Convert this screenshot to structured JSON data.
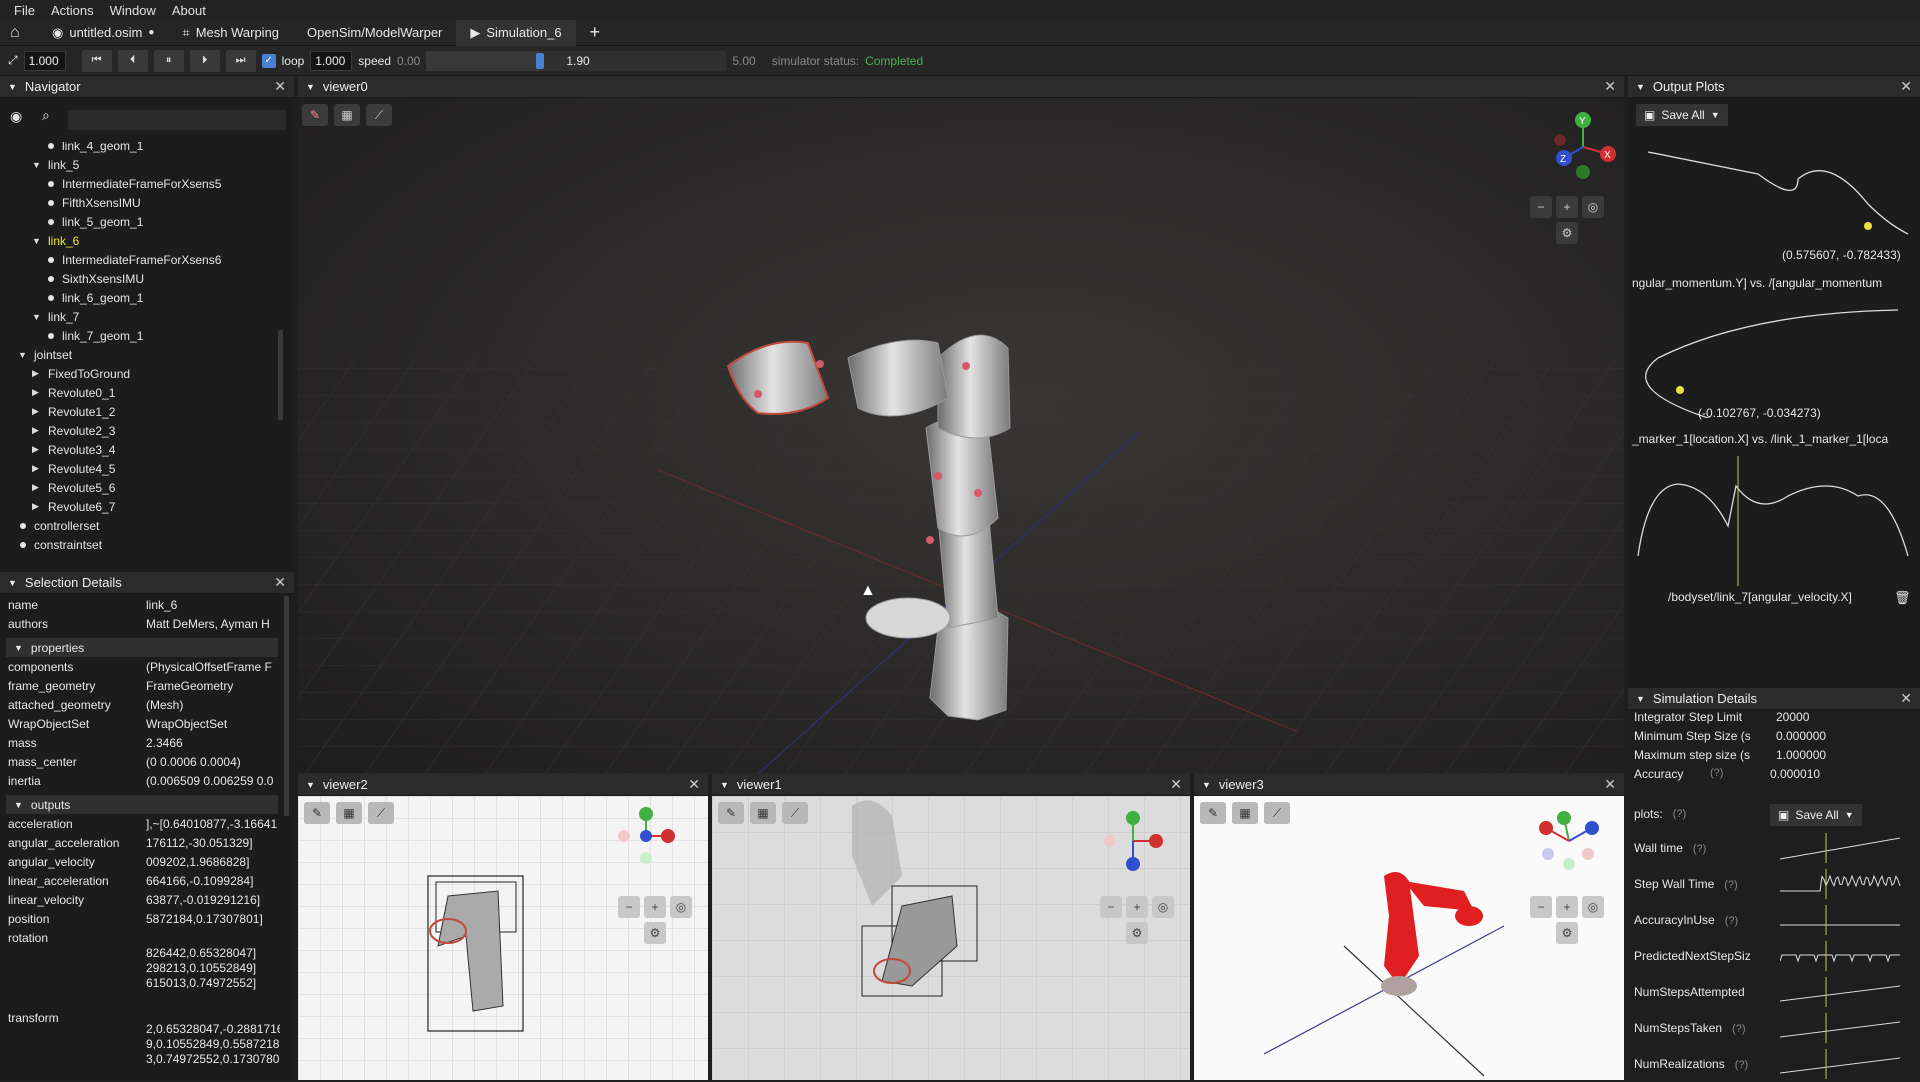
{
  "menu": [
    "File",
    "Actions",
    "Window",
    "About"
  ],
  "tabs": [
    {
      "label": "untitled.osim",
      "modified": "●",
      "icon": "model-icon"
    },
    {
      "label": "Mesh Warping",
      "icon": "mesh-warp-icon"
    },
    {
      "label": "OpenSim/ModelWarper",
      "icon": ""
    },
    {
      "label": "Simulation_6",
      "icon": "play-icon"
    }
  ],
  "toolbar": {
    "scale": "1.000",
    "loop_label": "loop",
    "loop_value": "1.000",
    "speed_label": "speed",
    "time_start": "0.00",
    "time_current": "1.90",
    "time_end": "5.00",
    "status_label": "simulator status:",
    "status_value": "Completed",
    "time_fraction": 0.38
  },
  "navigator": {
    "title": "Navigator",
    "items": [
      {
        "label": "link_4_geom_1",
        "type": "dot",
        "level": 3
      },
      {
        "label": "link_5",
        "type": "open",
        "level": 2
      },
      {
        "label": "IntermediateFrameForXsens5",
        "type": "dot",
        "level": 3
      },
      {
        "label": "FifthXsensIMU",
        "type": "dot",
        "level": 3
      },
      {
        "label": "link_5_geom_1",
        "type": "dot",
        "level": 3
      },
      {
        "label": "link_6",
        "type": "open",
        "level": 2,
        "selected": true
      },
      {
        "label": "IntermediateFrameForXsens6",
        "type": "dot",
        "level": 3
      },
      {
        "label": "SixthXsensIMU",
        "type": "dot",
        "level": 3
      },
      {
        "label": "link_6_geom_1",
        "type": "dot",
        "level": 3
      },
      {
        "label": "link_7",
        "type": "open",
        "level": 2
      },
      {
        "label": "link_7_geom_1",
        "type": "dot",
        "level": 3
      },
      {
        "label": "jointset",
        "type": "open",
        "level": 1
      },
      {
        "label": "FixedToGround",
        "type": "closed",
        "level": 2
      },
      {
        "label": "Revolute0_1",
        "type": "closed",
        "level": 2
      },
      {
        "label": "Revolute1_2",
        "type": "closed",
        "level": 2
      },
      {
        "label": "Revolute2_3",
        "type": "closed",
        "level": 2
      },
      {
        "label": "Revolute3_4",
        "type": "closed",
        "level": 2
      },
      {
        "label": "Revolute4_5",
        "type": "closed",
        "level": 2
      },
      {
        "label": "Revolute5_6",
        "type": "closed",
        "level": 2
      },
      {
        "label": "Revolute6_7",
        "type": "closed",
        "level": 2
      },
      {
        "label": "controllerset",
        "type": "dot",
        "level": 1
      },
      {
        "label": "constraintset",
        "type": "dot",
        "level": 1
      }
    ]
  },
  "selection": {
    "title": "Selection Details",
    "top": [
      {
        "k": "name",
        "v": "link_6"
      },
      {
        "k": "authors",
        "v": "Matt DeMers, Ayman H"
      }
    ],
    "properties_label": "properties",
    "properties": [
      {
        "k": "components",
        "v": "(PhysicalOffsetFrame F"
      },
      {
        "k": "frame_geometry",
        "v": "FrameGeometry"
      },
      {
        "k": "attached_geometry",
        "v": "(Mesh)"
      },
      {
        "k": "WrapObjectSet",
        "v": "WrapObjectSet"
      },
      {
        "k": "mass",
        "v": "2.3466"
      },
      {
        "k": "mass_center",
        "v": "(0 0.0006 0.0004)"
      },
      {
        "k": "inertia",
        "v": "(0.006509 0.006259 0.0"
      }
    ],
    "outputs_label": "outputs",
    "outputs": [
      {
        "k": "acceleration",
        "v": "],~[0.64010877,-3.16641"
      },
      {
        "k": "angular_acceleration",
        "v": "176112,-30.051329]"
      },
      {
        "k": "angular_velocity",
        "v": "009202,1.9686828]"
      },
      {
        "k": "linear_acceleration",
        "v": "664166,-0.1099284]"
      },
      {
        "k": "linear_velocity",
        "v": "63877,-0.019291216]"
      },
      {
        "k": "position",
        "v": "5872184,0.17307801]"
      },
      {
        "k": "rotation",
        "v": ""
      }
    ],
    "rotation_lines": [
      "826442,0.65328047]",
      "298213,0.10552849]",
      "615013,0.74972552]"
    ],
    "transform_label": "transform",
    "transform_lines": [
      "2,0.65328047,-0.2881716",
      "9,0.10552849,0.5587218",
      "3,0.74972552,0.17307801"
    ]
  },
  "viewers": {
    "main": "viewer0",
    "v2": "viewer2",
    "v1": "viewer1",
    "v3": "viewer3"
  },
  "output_plots": {
    "title": "Output Plots",
    "save_all": "Save All",
    "plot1_coord": "(0.575607, -0.782433)",
    "plot1_label": "ngular_momentum.Y] vs. /[angular_momentum",
    "plot2_coord": "(-0.102767, -0.034273)",
    "plot2_label": "_marker_1[location.X] vs. /link_1_marker_1[loca",
    "plot3_label": "/bodyset/link_7[angular_velocity.X]"
  },
  "sim_details": {
    "title": "Simulation Details",
    "rows": [
      {
        "k": "Integrator Step Limit",
        "v": "20000",
        "q": ""
      },
      {
        "k": "Minimum Step Size (s",
        "v": "0.000000",
        "q": ""
      },
      {
        "k": "Maximum step size (s",
        "v": "1.000000",
        "q": ""
      },
      {
        "k": "Accuracy",
        "v": "0.000010",
        "q": "(?)"
      }
    ],
    "plots_label": "plots:",
    "plots_q": "(?)",
    "save_all": "Save All",
    "plots": [
      {
        "k": "Wall time",
        "q": "(?)"
      },
      {
        "k": "Step Wall Time",
        "q": "(?)"
      },
      {
        "k": "AccuracyInUse",
        "q": "(?)"
      },
      {
        "k": "PredictedNextStepSiz",
        "q": ""
      },
      {
        "k": "NumStepsAttempted",
        "q": ""
      },
      {
        "k": "NumStepsTaken",
        "q": "(?)"
      },
      {
        "k": "NumRealizations",
        "q": "(?)"
      }
    ]
  },
  "axes": {
    "x": "X",
    "y": "Y",
    "z": "Z"
  },
  "colors": {
    "accent": "#4a7fd6",
    "status": "#4caf50",
    "selected": "#f0e340",
    "axis_x": "#d03030",
    "axis_y": "#40b040",
    "axis_z": "#3050d0"
  }
}
